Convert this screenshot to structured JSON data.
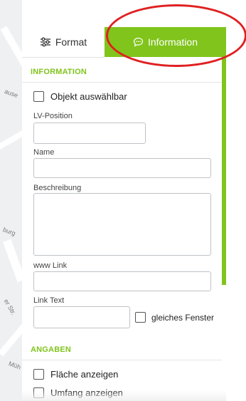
{
  "tabs": {
    "format_label": "Format",
    "info_label": "Information"
  },
  "information": {
    "section_title": "INFORMATION",
    "select_object_label": "Objekt auswählbar",
    "lv_position_label": "LV-Position",
    "name_label": "Name",
    "description_label": "Beschreibung",
    "www_link_label": "www Link",
    "link_text_label": "Link Text",
    "same_window_label": "gleiches Fenster"
  },
  "details": {
    "section_title": "ANGABEN",
    "show_area_label": "Fläche anzeigen",
    "show_perimeter_label": "Umfang anzeigen"
  },
  "map": {
    "labels": [
      "ause",
      "burg",
      "er Str.",
      "Müh"
    ]
  },
  "colors": {
    "accent": "#80c41c",
    "highlight": "#e02020"
  }
}
